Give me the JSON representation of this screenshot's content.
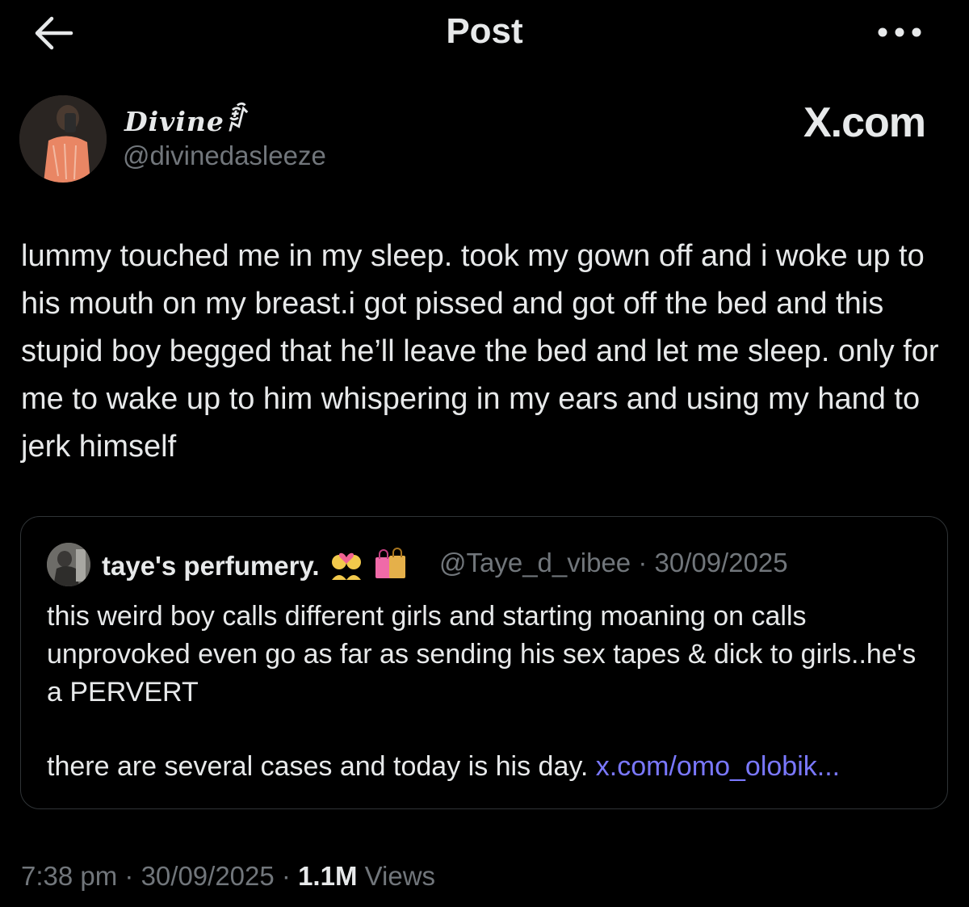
{
  "header": {
    "title": "Post",
    "back_icon": "arrow-left-icon",
    "more_icon": "more-horizontal-icon"
  },
  "author": {
    "display_name": "Divine",
    "name_symbol": "ꆋ",
    "username": "@divinedasleeze"
  },
  "brand": "X.com",
  "post": {
    "text": "lummy touched me in my sleep. took my gown off and i woke up to his mouth on my breast.i got pissed and got off the bed and this stupid boy begged that he’ll leave the bed and let me sleep. only for me to wake up to him whispering in my ears and using my hand to jerk himself"
  },
  "quote": {
    "name": "taye's perfumery.",
    "emojis": [
      "couple-with-heart-icon",
      "shopping-bags-icon"
    ],
    "meta": "@Taye_d_vibee · 30/09/2025",
    "text": "this weird boy calls different girls and starting moaning on calls unprovoked even go as far as sending his sex tapes & dick to girls..he's a PERVERT",
    "text2": "there are several cases and today is his day.",
    "link": "x.com/omo_olobik..."
  },
  "footer": {
    "time": "7:38 pm",
    "separator": " · ",
    "date": "30/09/2025",
    "views_count": "1.1M",
    "views_label": " Views"
  },
  "colors": {
    "background": "#000000",
    "text": "#e7e9ea",
    "secondary": "#71767b",
    "link": "#7a78ff",
    "border": "#2f3336"
  }
}
